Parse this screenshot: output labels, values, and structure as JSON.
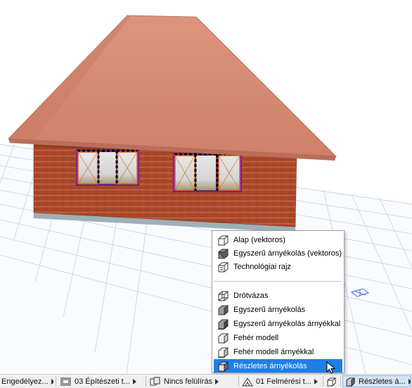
{
  "view_menu": {
    "items": [
      {
        "label": "Alap (vektoros)",
        "icon": "basic-vector-render-icon"
      },
      {
        "label": "Egyszerű árnyékolás (vektoros)",
        "icon": "simple-shading-vector-icon"
      },
      {
        "label": "Technológiai rajz",
        "icon": "technical-drawing-icon"
      },
      {
        "label": "Drótvázas",
        "icon": "wireframe-icon"
      },
      {
        "label": "Egyszerű árnyékolás",
        "icon": "simple-shading-icon"
      },
      {
        "label": "Egyszerű árnyékolás árnyékkal",
        "icon": "simple-shading-shadow-icon"
      },
      {
        "label": "Fehér modell",
        "icon": "white-model-icon"
      },
      {
        "label": "Fehér modell árnyékkal",
        "icon": "white-model-shadow-icon"
      },
      {
        "label": "Részletes árnyékolás",
        "icon": "detailed-shading-icon",
        "selected": true
      }
    ]
  },
  "status_bar": {
    "permit": "Engedélyez...",
    "layer_combo": "03 Építészeti t...",
    "override": "Nincs felülírás",
    "survey": "01 Felmérési t...",
    "render_mode": "Részletes á..."
  },
  "colors": {
    "selection": "#1e7fe6",
    "roof": "#d88a74",
    "brick": "#b04a2e",
    "grid": "#a9c4ec",
    "window_frame": "#e07020"
  }
}
